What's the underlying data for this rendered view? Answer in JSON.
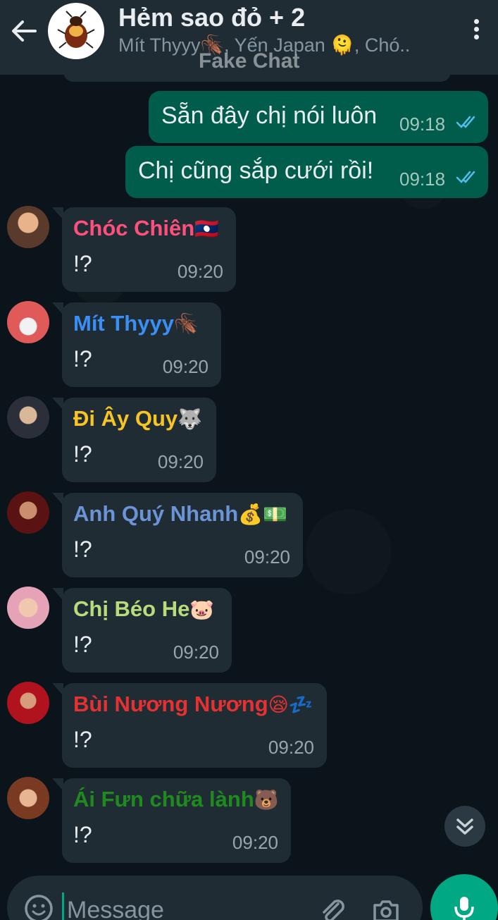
{
  "header": {
    "title": "Hẻm sao đỏ + 2",
    "subtitle": "Mít Thyyy🪳, Yến Japan 🫠, Chó..",
    "watermark": "Fake Chat"
  },
  "outgoing": [
    {
      "text": "Sẵn đây chị nói luôn",
      "time": "09:18"
    },
    {
      "text": "Chị cũng sắp cưới rồi!",
      "time": "09:18"
    }
  ],
  "incoming": [
    {
      "sender": "Chóc Chiên",
      "emoji": "🇱🇦",
      "text": "!?",
      "time": "09:20",
      "color": "#ff4f7d"
    },
    {
      "sender": "Mít Thyyy",
      "emoji": "🪳",
      "text": "!?",
      "time": "09:20",
      "color": "#3a8ff7"
    },
    {
      "sender": "Đi Ây Quy",
      "emoji": "🐺",
      "text": "!?",
      "time": "09:20",
      "color": "#f7c325"
    },
    {
      "sender": "Anh Quý Nhanh",
      "emoji": "💰💵",
      "text": "!?",
      "time": "09:20",
      "color": "#6b93d6"
    },
    {
      "sender": "Chị Béo He",
      "emoji": "🐷",
      "text": "!?",
      "time": "09:20",
      "color": "#b8dc7c"
    },
    {
      "sender": "Bùi Nương Nương",
      "emoji": "😪💤",
      "text": "!?",
      "time": "09:20",
      "color": "#e53131"
    },
    {
      "sender": "Ái Fưn chữa lành",
      "emoji": "🐻",
      "text": "!?",
      "time": "09:20",
      "color": "#1f8b1f"
    }
  ],
  "input": {
    "placeholder": "Message"
  },
  "colors": {
    "header_bg": "#1f2c34",
    "outgoing_bubble": "#005c4b",
    "incoming_bubble": "#202c33",
    "accent": "#00a884",
    "tick_blue": "#53bdeb"
  },
  "icons": [
    "back-arrow-icon",
    "kebab-menu-icon",
    "double-tick-icon",
    "chevrons-down-icon",
    "emoji-icon",
    "paperclip-icon",
    "camera-icon",
    "microphone-icon"
  ]
}
